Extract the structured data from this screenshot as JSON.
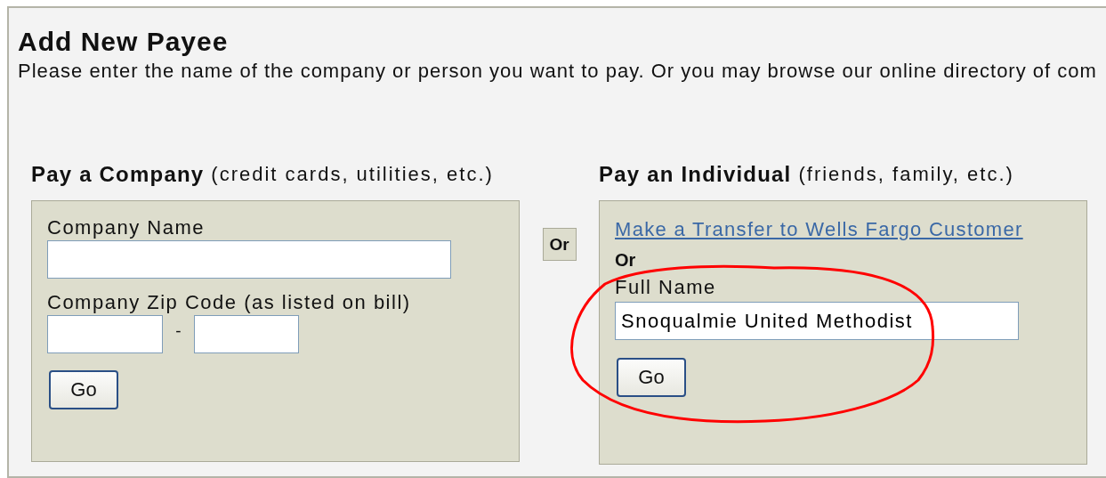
{
  "title": "Add New Payee",
  "intro": "Please enter the name of the company or person you want to pay. Or you may browse our online directory of com",
  "company": {
    "heading": "Pay a Company",
    "note": "(credit cards, utilities, etc.)",
    "name_label": "Company Name",
    "zip_label": "Company Zip Code (as listed on bill)",
    "zip_separator": "-",
    "button": "Go"
  },
  "separator": "Or",
  "individual": {
    "heading": "Pay an Individual",
    "note": "(friends, family, etc.)",
    "link": "Make a Transfer to Wells Fargo Customer",
    "or": "Or",
    "name_label": "Full Name",
    "name_value": "Snoqualmie United Methodist",
    "button": "Go"
  }
}
